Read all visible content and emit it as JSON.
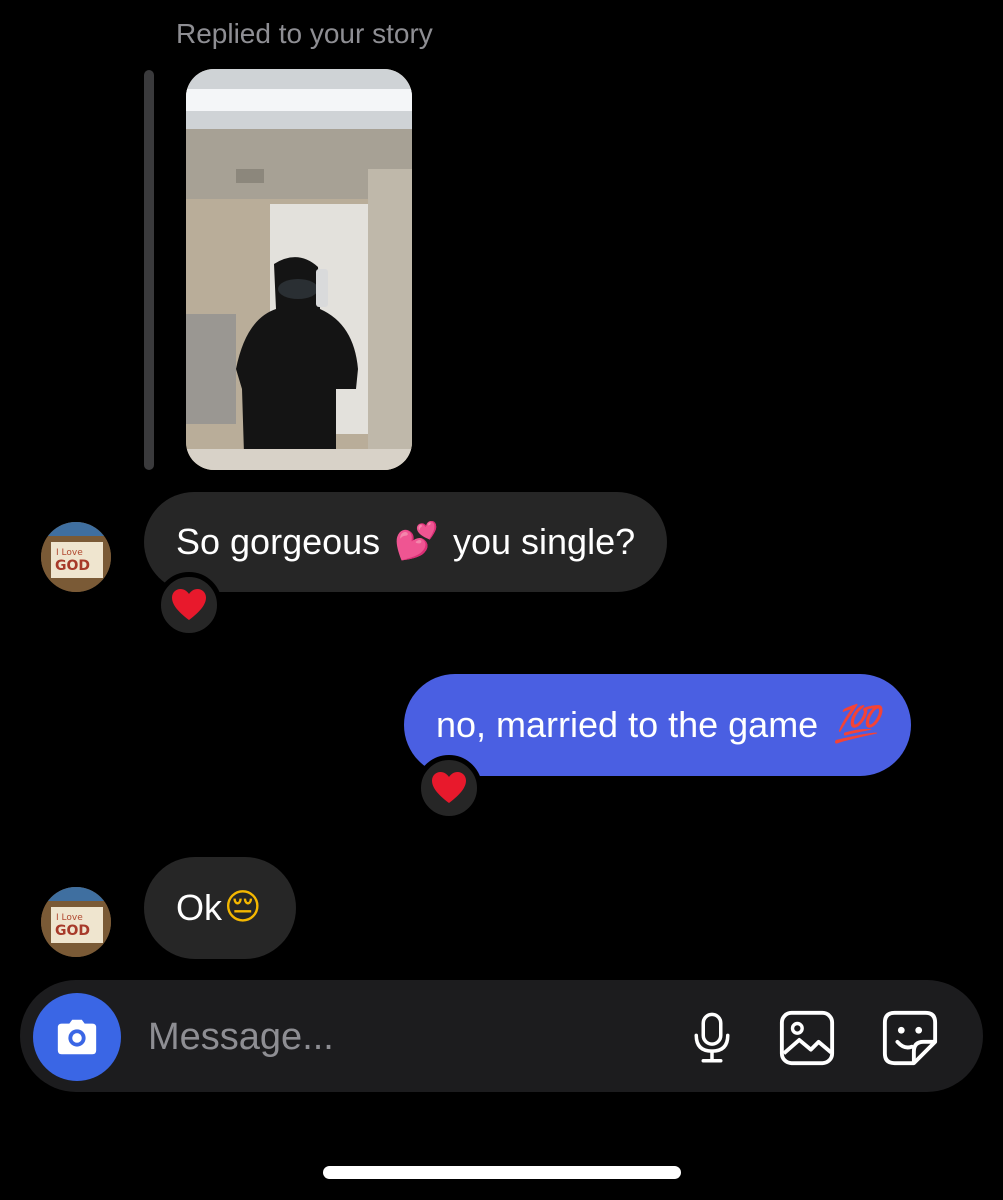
{
  "story_reply": {
    "label": "Replied to your story"
  },
  "messages": [
    {
      "direction": "incoming",
      "text": "So gorgeous",
      "emoji": "💕",
      "text_after": "you single?",
      "reaction": "heart"
    },
    {
      "direction": "outgoing",
      "text": "no, married to the game",
      "emoji": "💯",
      "reaction": "heart"
    },
    {
      "direction": "incoming",
      "text": "Ok",
      "emoji": "😔"
    }
  ],
  "avatar": {
    "text_line1": "I Love",
    "text_line2": "GOD"
  },
  "composer": {
    "placeholder": "Message...",
    "icons": [
      "camera-icon",
      "microphone-icon",
      "gallery-icon",
      "sticker-icon"
    ]
  },
  "colors": {
    "outgoing_bubble": "#4a5fe2",
    "incoming_bubble": "#262626",
    "camera_button": "#3a66e5",
    "reaction_heart": "#e8192c"
  }
}
